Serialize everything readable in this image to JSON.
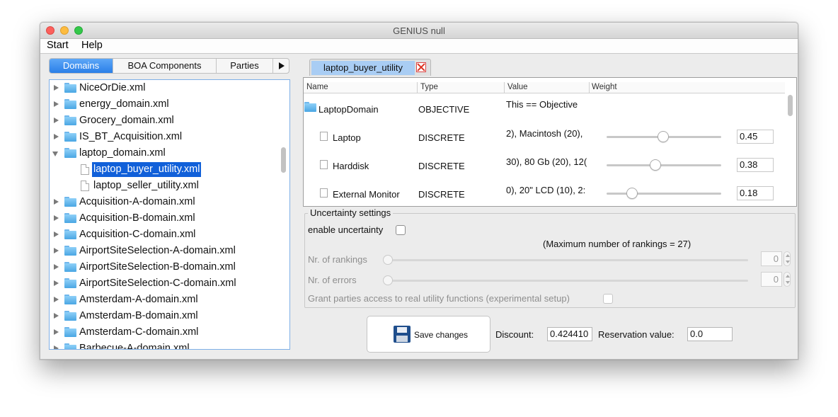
{
  "window": {
    "title": "GENIUS null"
  },
  "menu": [
    "Start",
    "Help"
  ],
  "left_tabs": [
    "Domains",
    "BOA Components",
    "Parties"
  ],
  "tree": [
    {
      "label": "NiceOrDie.xml",
      "kind": "folder"
    },
    {
      "label": "energy_domain.xml",
      "kind": "folder"
    },
    {
      "label": "Grocery_domain.xml",
      "kind": "folder"
    },
    {
      "label": "IS_BT_Acquisition.xml",
      "kind": "folder"
    },
    {
      "label": "laptop_domain.xml",
      "kind": "folder-open"
    },
    {
      "label": "laptop_buyer_utility.xml",
      "kind": "file-selected"
    },
    {
      "label": "laptop_seller_utility.xml",
      "kind": "file"
    },
    {
      "label": "Acquisition-A-domain.xml",
      "kind": "folder"
    },
    {
      "label": "Acquisition-B-domain.xml",
      "kind": "folder"
    },
    {
      "label": "Acquisition-C-domain.xml",
      "kind": "folder"
    },
    {
      "label": "AirportSiteSelection-A-domain.xml",
      "kind": "folder"
    },
    {
      "label": "AirportSiteSelection-B-domain.xml",
      "kind": "folder"
    },
    {
      "label": "AirportSiteSelection-C-domain.xml",
      "kind": "folder"
    },
    {
      "label": "Amsterdam-A-domain.xml",
      "kind": "folder"
    },
    {
      "label": "Amsterdam-B-domain.xml",
      "kind": "folder"
    },
    {
      "label": "Amsterdam-C-domain.xml",
      "kind": "folder"
    },
    {
      "label": "Barbecue-A-domain.xml",
      "kind": "folder"
    }
  ],
  "editor": {
    "tab_label": "laptop_buyer_utility",
    "columns": [
      "Name",
      "Type",
      "Value",
      "Weight"
    ],
    "rows": [
      {
        "name": "LaptopDomain",
        "type": "OBJECTIVE",
        "value": "This == Objective",
        "weight": null
      },
      {
        "name": "Laptop",
        "type": "DISCRETE",
        "value": "2), Macintosh (20),",
        "weight": "0.45",
        "level": 0.45
      },
      {
        "name": "Harddisk",
        "type": "DISCRETE",
        "value": "30), 80 Gb (20), 12(",
        "weight": "0.38",
        "level": 0.38
      },
      {
        "name": "External Monitor",
        "type": "DISCRETE",
        "value": "0), 20\" LCD (10), 2:",
        "weight": "0.18",
        "level": 0.18
      }
    ]
  },
  "uncertainty": {
    "title": "Uncertainty settings",
    "enable_label": "enable uncertainty",
    "max_note": "(Maximum number of rankings = 27)",
    "rankings_label": "Nr. of rankings",
    "rankings_value": "0",
    "errors_label": "Nr. of errors",
    "errors_value": "0",
    "grant_label": "Grant parties access to real utility functions (experimental setup)"
  },
  "footer": {
    "save_label": "Save changes",
    "discount_label": "Discount:",
    "discount_value": "0.424410",
    "reservation_label": "Reservation value:",
    "reservation_value": "0.0"
  },
  "icons": [
    "folder-icon",
    "file-icon",
    "floppy-disk-icon",
    "close-tab-icon",
    "tab-scroll-right-icon"
  ]
}
